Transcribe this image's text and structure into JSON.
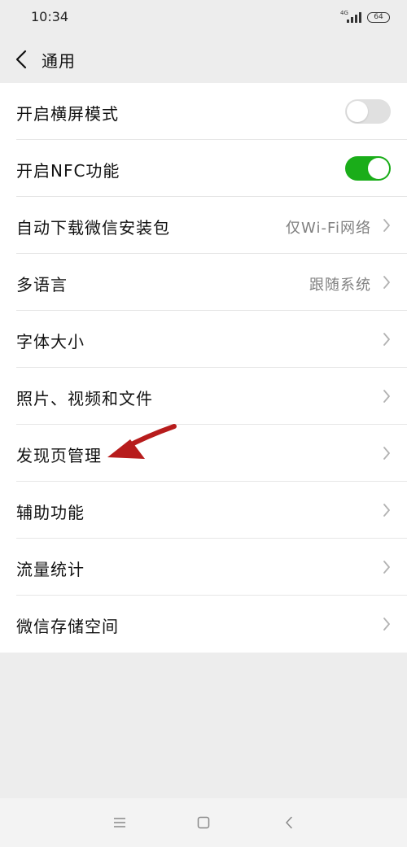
{
  "status_bar": {
    "time": "10:34",
    "network": "4G",
    "battery": "64"
  },
  "nav": {
    "title": "通用",
    "back_icon": "chevron-left-icon"
  },
  "settings": [
    {
      "label": "开启横屏模式",
      "control": "toggle",
      "on": false
    },
    {
      "label": "开启NFC功能",
      "control": "toggle",
      "on": true
    },
    {
      "label": "自动下载微信安装包",
      "value": "仅Wi-Fi网络",
      "control": "chevron"
    },
    {
      "label": "多语言",
      "value": "跟随系统",
      "control": "chevron"
    },
    {
      "label": "字体大小",
      "control": "chevron"
    },
    {
      "label": "照片、视频和文件",
      "control": "chevron"
    },
    {
      "label": "发现页管理",
      "control": "chevron"
    },
    {
      "label": "辅助功能",
      "control": "chevron"
    },
    {
      "label": "流量统计",
      "control": "chevron"
    },
    {
      "label": "微信存储空间",
      "control": "chevron"
    }
  ],
  "annotation": {
    "icon": "red-arrow-icon",
    "color": "#b71c1c"
  },
  "colors": {
    "toggle_on": "#1aad19",
    "toggle_off": "#e0e0e0",
    "page_bg": "#ededed"
  },
  "system_nav": [
    "menu-icon",
    "home-icon",
    "back-icon"
  ]
}
